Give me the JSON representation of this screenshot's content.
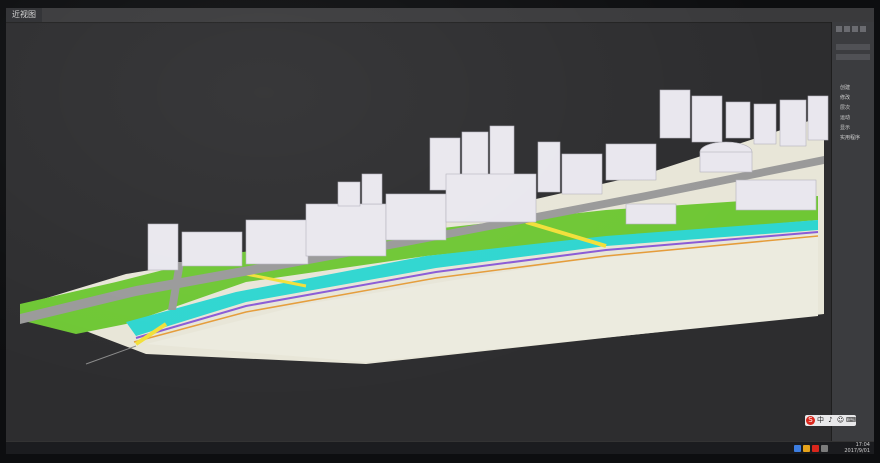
{
  "window": {
    "tab_label": "近视图"
  },
  "viewport": {
    "label": "",
    "scene": "riverfront-city-model"
  },
  "command_panel": {
    "items": [
      "创建",
      "修改",
      "层次",
      "运动",
      "显示",
      "实用程序"
    ]
  },
  "ime_toolbar": {
    "items": [
      "S",
      "中",
      "♪",
      "☺",
      "⌨"
    ]
  },
  "taskbar": {
    "time": "17:04",
    "date": "2017/9/01"
  },
  "colors": {
    "background": "#2d2d2f",
    "ground": "#e8e6d8",
    "grass": "#6fc735",
    "water": "#2fd6d0",
    "road": "#9a9a9a",
    "building": "#e9e7ee",
    "highlight": "#f2e03a",
    "accent_purple": "#8a5bd6"
  }
}
